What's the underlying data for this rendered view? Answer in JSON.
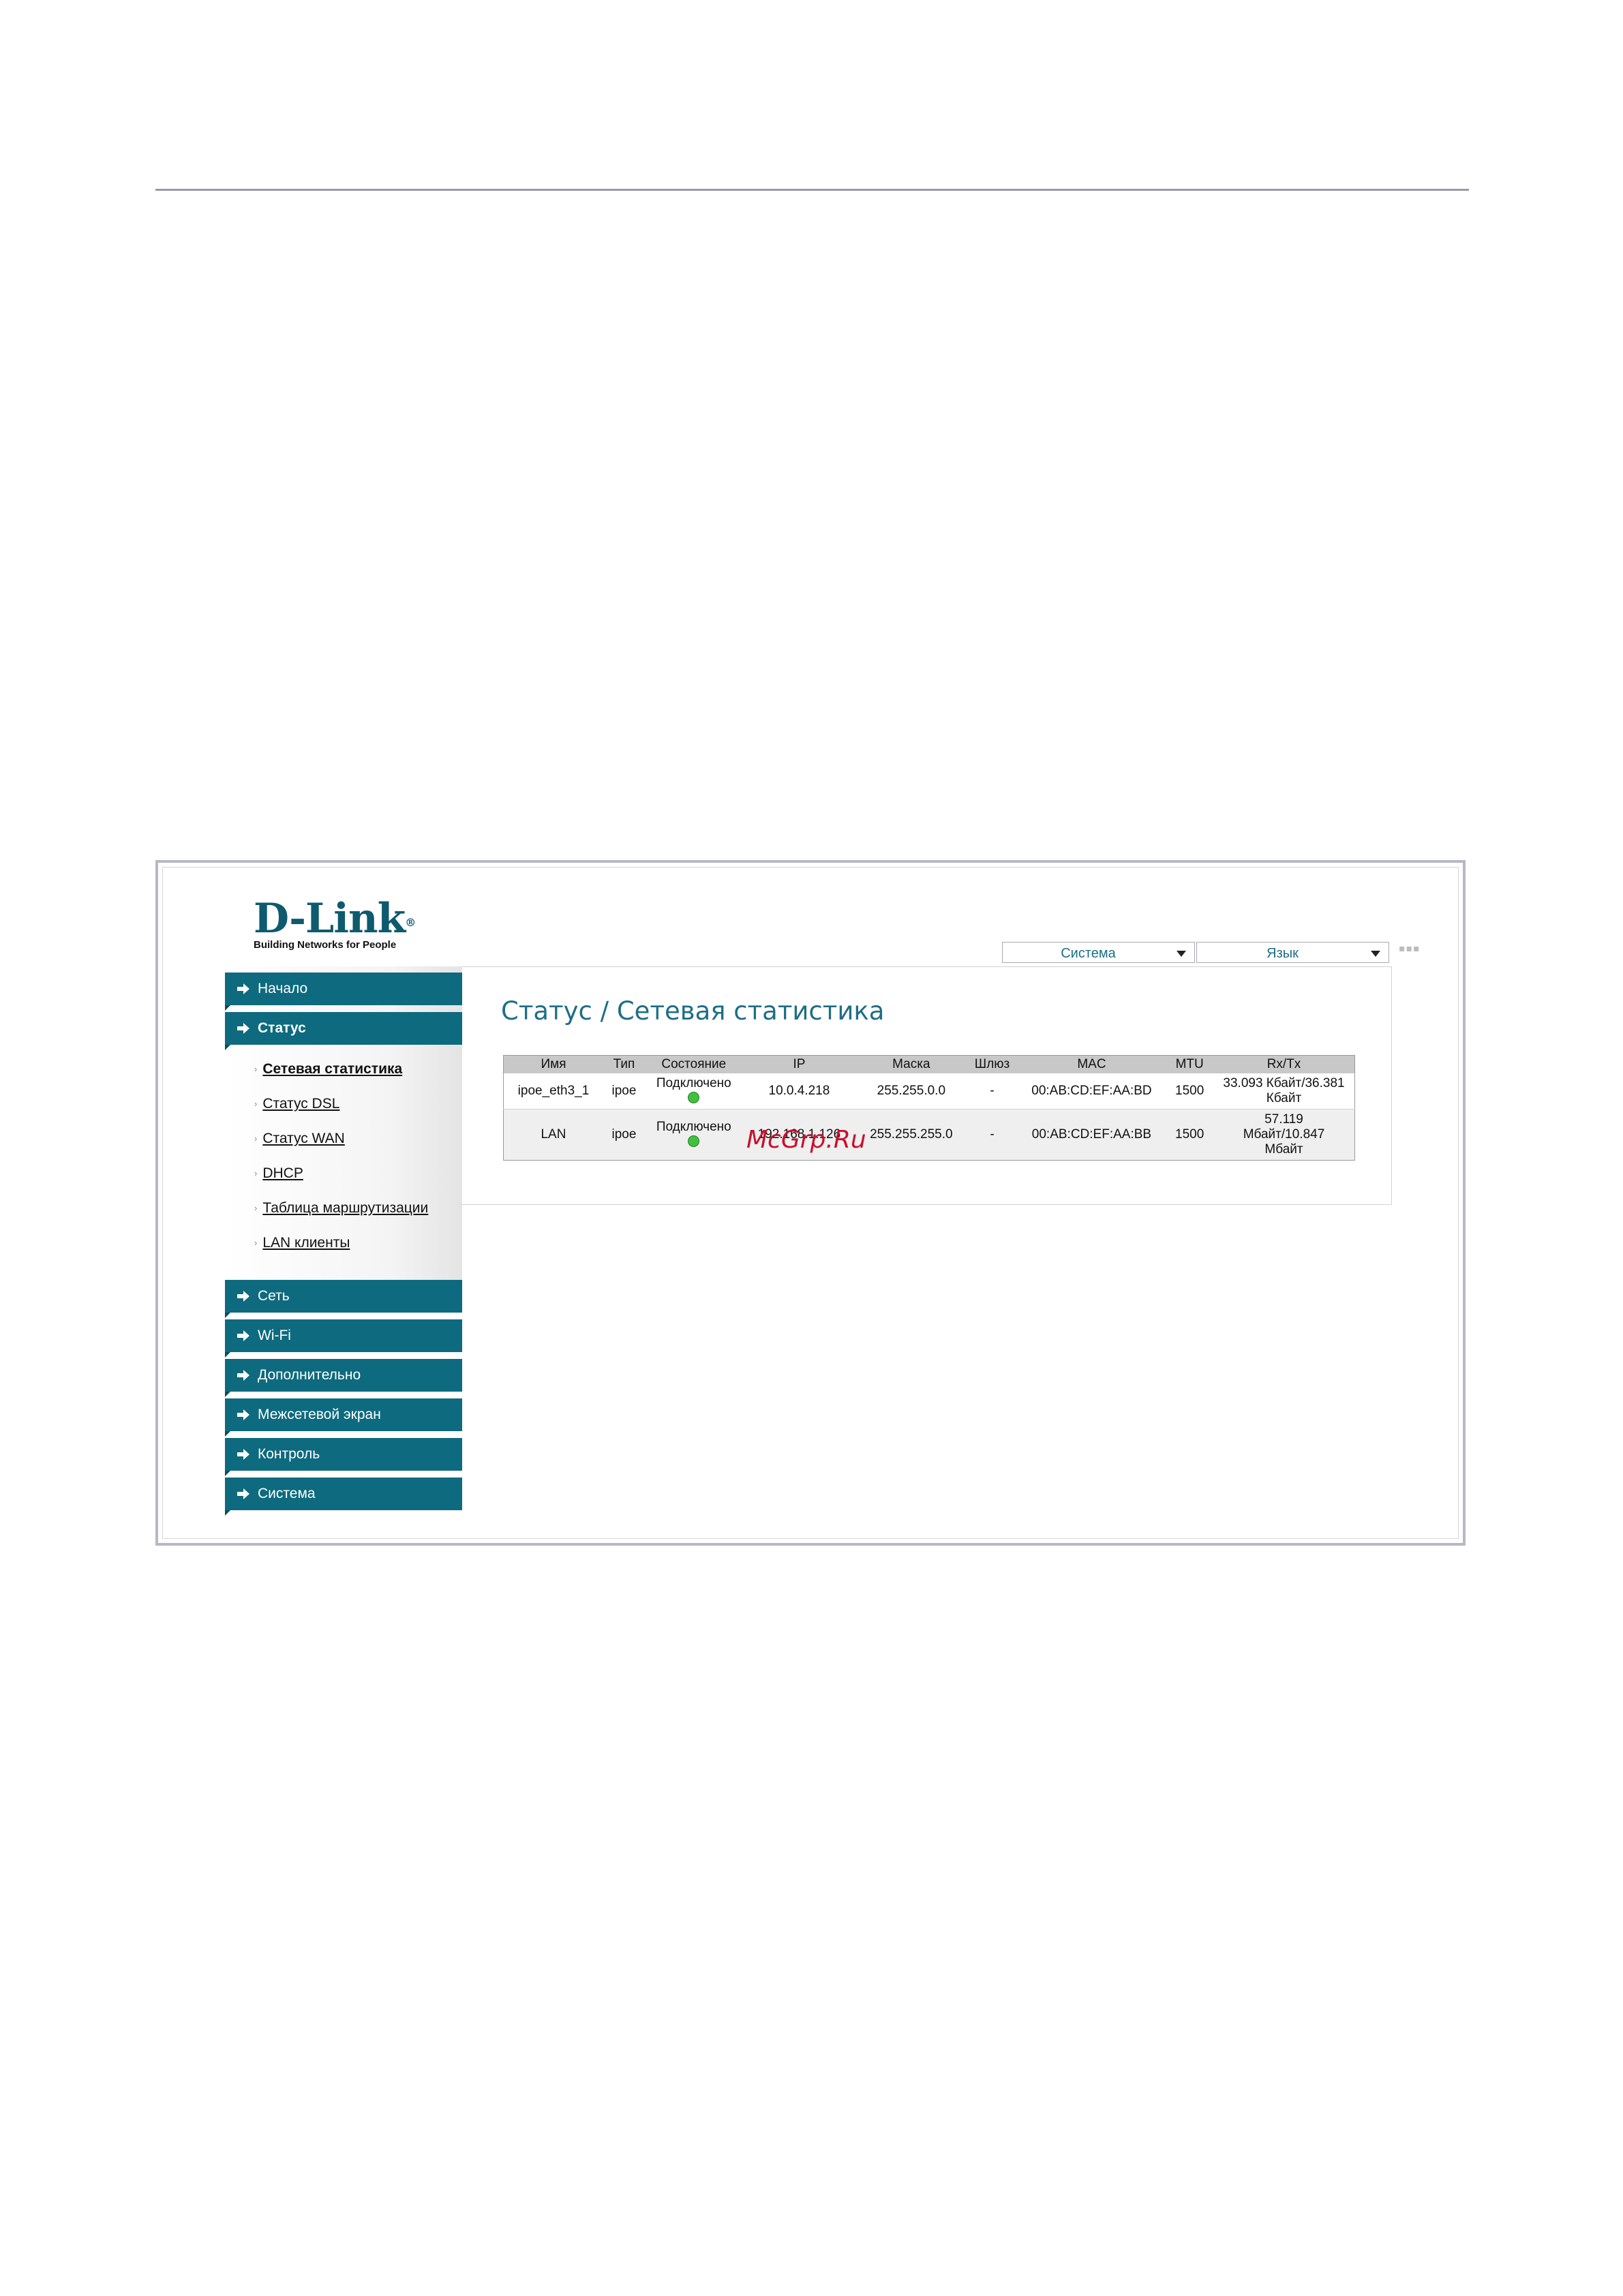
{
  "brand": {
    "logo_text": "D-Link",
    "registered": "®",
    "tagline": "Building Networks for People"
  },
  "topbar": {
    "system_dropdown": "Система",
    "language_dropdown": "Язык",
    "dots": "▪▪▪"
  },
  "page": {
    "title": "Статус / Сетевая статистика"
  },
  "sidebar": {
    "items": [
      {
        "label": "Начало"
      },
      {
        "label": "Статус"
      },
      {
        "label": "Сеть"
      },
      {
        "label": "Wi-Fi"
      },
      {
        "label": "Дополнительно"
      },
      {
        "label": "Межсетевой экран"
      },
      {
        "label": "Контроль"
      },
      {
        "label": "Система"
      }
    ],
    "sub_items": [
      {
        "label": "Сетевая статистика"
      },
      {
        "label": "Статус DSL"
      },
      {
        "label": "Статус WAN"
      },
      {
        "label": "DHCP"
      },
      {
        "label": "Таблица маршрутизации"
      },
      {
        "label": "LAN клиенты"
      }
    ]
  },
  "table": {
    "headers": [
      "Имя",
      "Тип",
      "Состояние",
      "IP",
      "Маска",
      "Шлюз",
      "MAC",
      "MTU",
      "Rx/Tx"
    ],
    "rows": [
      {
        "name": "ipoe_eth3_1",
        "type": "ipoe",
        "state": "Подключено",
        "ip": "10.0.4.218",
        "mask": "255.255.0.0",
        "gateway": "-",
        "mac": "00:AB:CD:EF:AA:BD",
        "mtu": "1500",
        "rxtx": "33.093 Кбайт/36.381 Кбайт"
      },
      {
        "name": "LAN",
        "type": "ipoe",
        "state": "Подключено",
        "ip": "192.168.1.126",
        "mask": "255.255.255.0",
        "gateway": "-",
        "mac": "00:AB:CD:EF:AA:BB",
        "mtu": "1500",
        "rxtx": "57.119 Мбайт/10.847 Мбайт"
      }
    ]
  },
  "watermark": "McGrp.Ru",
  "colors": {
    "accent": "#0e6a7e",
    "title": "#1e6e86",
    "status_ok": "#3ec23e",
    "watermark": "#c8102e"
  }
}
